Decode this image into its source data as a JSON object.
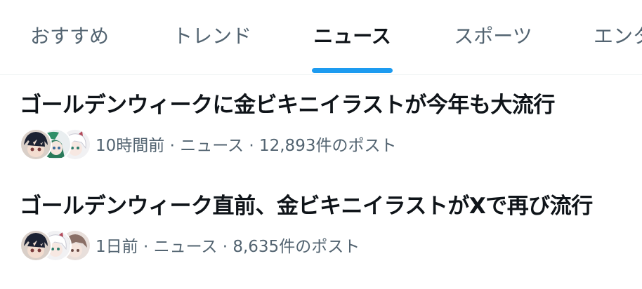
{
  "tabs": [
    {
      "label": "おすすめ",
      "active": false
    },
    {
      "label": "トレンド",
      "active": false
    },
    {
      "label": "ニュース",
      "active": true
    },
    {
      "label": "スポーツ",
      "active": false
    },
    {
      "label": "エンタ",
      "active": false
    }
  ],
  "news": [
    {
      "headline": "ゴールデンウィークに金ビキニイラストが今年も大流行",
      "meta": "10時間前 · ニュース · 12,893件のポスト"
    },
    {
      "headline": "ゴールデンウィーク直前、金ビキニイラストがXで再び流行",
      "meta": "1日前 · ニュース · 8,635件のポスト"
    }
  ],
  "colors": {
    "accent": "#1d9bf0",
    "text_primary": "#0f1419",
    "text_secondary": "#536471",
    "divider": "#eff3f4"
  }
}
